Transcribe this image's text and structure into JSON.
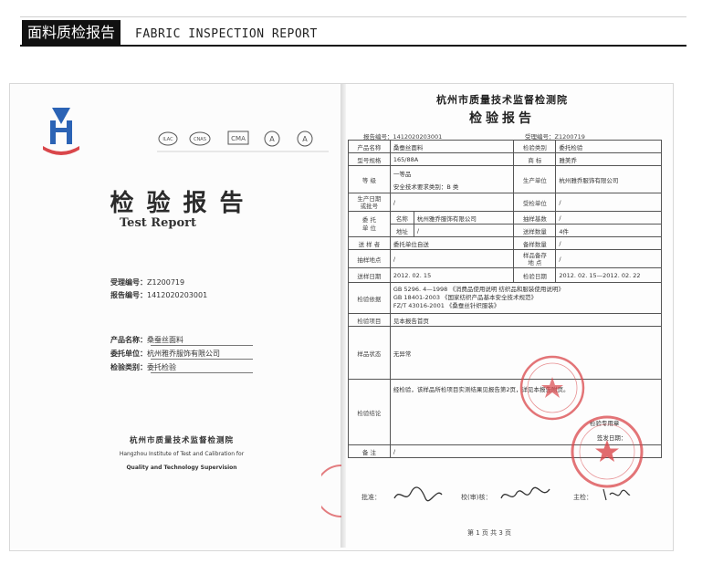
{
  "header": {
    "title_cn": "面料质检报告",
    "title_en": "FABRIC INSPECTION REPORT"
  },
  "cover": {
    "title_cn": "检验报告",
    "title_en": "Test Report",
    "accept_no_label": "受理编号：",
    "accept_no": "Z1200719",
    "report_no_label": "报告编号：",
    "report_no": "1412020203001",
    "product_label": "产品名称：",
    "product": "桑蚕丝面料",
    "client_label": "委托单位：",
    "client": "杭州雅乔服饰有限公司",
    "category_label": "检验类别：",
    "category": "委托检验",
    "institute_cn": "杭州市质量技术监督检测院",
    "institute_en_1": "Hangzhou Institute of Test and Calibration for",
    "institute_en_2": "Quality and Technology Supervision"
  },
  "report": {
    "institute": "杭州市质量技术监督检测院",
    "title": "检验报告",
    "report_no_label": "报告编号：",
    "report_no": "1412020203001",
    "accept_no_label": "受理编号：",
    "accept_no": "Z1200719",
    "rows": {
      "product_name_l": "产品名称",
      "product_name_v": "桑蚕丝面料",
      "test_type_l": "检验类别",
      "test_type_v": "委托检验",
      "model_l": "型号规格",
      "model_v": "165/88A",
      "brand_l": "商    标",
      "brand_v": "雅美乔",
      "grade_l": "等    级",
      "grade_v1": "一等品",
      "grade_v2": "安全技术要求类别：B 类",
      "maker_l": "生产单位",
      "maker_v": "杭州雅乔服饰有限公司",
      "batch_l": "生产日期\n或批号",
      "batch_v": "/",
      "accept_date_l": "受检单位",
      "accept_date_v": "/",
      "client_l": "委 托\n单 位",
      "client_name_l": "名称",
      "client_name_v": "杭州雅乔服饰有限公司",
      "base_qty_l": "抽样基数",
      "base_qty_v": "/",
      "client_addr_l": "地址",
      "client_addr_v": "/",
      "sample_qty_l": "送样数量",
      "sample_qty_v": "4件",
      "sender_l": "送 样 者",
      "sender_v": "委托单位自送",
      "sample_no_l": "备样数量",
      "sample_no_v": "/",
      "sample_place_l": "抽样地点",
      "sample_place_v": "/",
      "storage_l": "样品备存\n地    点",
      "storage_v": "/",
      "arrive_l": "送样日期",
      "arrive_v": "2012. 02. 15",
      "test_date_l": "检验日期",
      "test_date_v": "2012. 02. 15—2012. 02. 22",
      "basis_l": "检验依据",
      "basis_v1": "GB 5296. 4—1998 《消费品使用说明  纺织品和服装使用说明》",
      "basis_v2": "GB 18401-2003 《国家纺织产品基本安全技术规范》",
      "basis_v3": "FZ/T 43016-2001 《桑蚕丝针织服装》",
      "items_l": "检验项目",
      "items_v": "见本报告首页",
      "state_l": "样品状态",
      "state_v": "无异常",
      "conclusion_l": "检验结论",
      "conclusion_v": "经检验，该样品所检项目实测结果见报告第2页，详见本报告附页。",
      "conclusion_stamp": "检验专用章",
      "conclusion_date": "签发日期：",
      "remark_l": "备    注",
      "remark_v": "/"
    },
    "approve_label": "批准：",
    "review_label": "校(审)核：",
    "main_label": "主检：",
    "page_text": "第 1 页  共 3 页"
  },
  "colors": {
    "stamp_red": "#d9464a",
    "logo_blue": "#2b63b5",
    "header_bg": "#111111"
  }
}
